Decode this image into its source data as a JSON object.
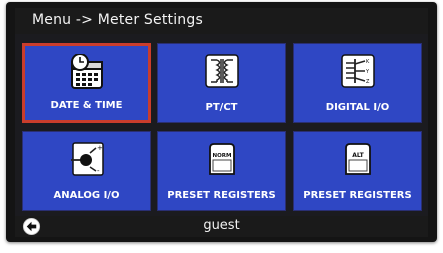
{
  "header": {
    "title": "Menu -> Meter Settings"
  },
  "tiles": [
    {
      "label": "DATE & TIME",
      "icon": "calendar-clock-icon",
      "selected": true
    },
    {
      "label": "PT/CT",
      "icon": "transformer-icon",
      "selected": false
    },
    {
      "label": "DIGITAL I/O",
      "icon": "digital-io-icon",
      "selected": false
    },
    {
      "label": "ANALOG I/O",
      "icon": "analog-io-icon",
      "selected": false
    },
    {
      "label": "PRESET REGISTERS",
      "icon": "preset-norm-icon",
      "icon_text": "NORM",
      "selected": false
    },
    {
      "label": "PRESET REGISTERS",
      "icon": "preset-alt-icon",
      "icon_text": "ALT",
      "selected": false
    }
  ],
  "status": {
    "user": "guest",
    "back_icon": "back-arrow-icon"
  },
  "colors": {
    "tile": "#2f47c4",
    "selected_border": "#ca3d2c",
    "background": "#1b1b1f"
  }
}
